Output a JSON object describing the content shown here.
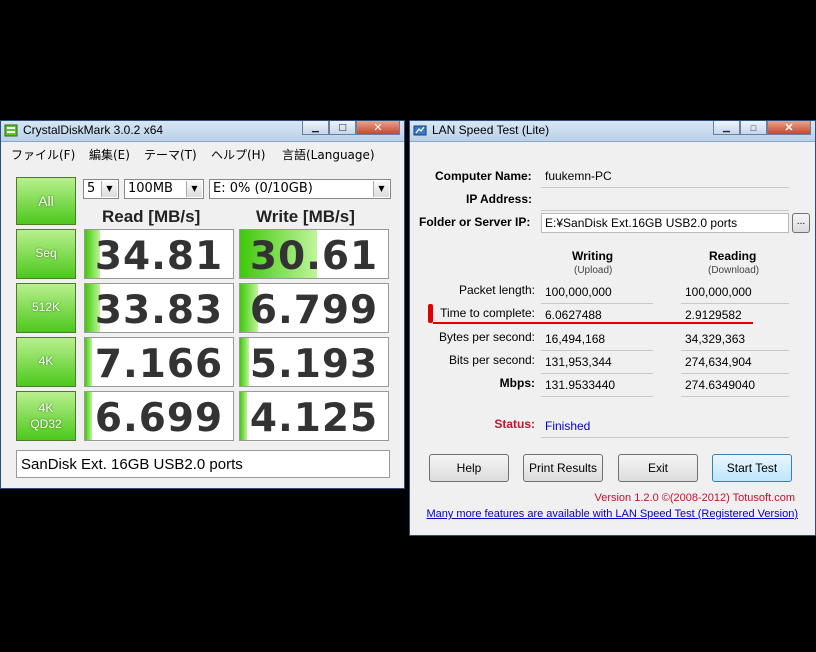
{
  "cdm": {
    "title": "CrystalDiskMark 3.0.2 x64",
    "menu": [
      "ファイル(F)",
      "編集(E)",
      "テーマ(T)",
      "ヘルプ(H)",
      "言語(Language)"
    ],
    "runs": "5",
    "size": "100MB",
    "drive": "E: 0% (0/10GB)",
    "all_label": "All",
    "read_header": "Read [MB/s]",
    "write_header": "Write [MB/s]",
    "tests": [
      {
        "label": "Seq",
        "label2": "",
        "read": "34.81",
        "write": "30.61",
        "read_fill": 0.1,
        "write_fill": 0.52
      },
      {
        "label": "512K",
        "label2": "",
        "read": "33.83",
        "write": "6.799",
        "read_fill": 0.1,
        "write_fill": 0.12
      },
      {
        "label": "4K",
        "label2": "",
        "read": "7.166",
        "write": "5.193",
        "read_fill": 0.05,
        "write_fill": 0.06
      },
      {
        "label": "4K",
        "label2": "QD32",
        "read": "6.699",
        "write": "4.125",
        "read_fill": 0.05,
        "write_fill": 0.05
      }
    ],
    "comment": "SanDisk Ext. 16GB USB2.0 ports",
    "accent": "#4cc81c"
  },
  "lst": {
    "title": "LAN Speed Test (Lite)",
    "computer_name_label": "Computer Name:",
    "computer_name": "fuukemn-PC",
    "ip_label": "IP Address:",
    "ip": "",
    "folder_label": "Folder or Server IP:",
    "folder": "E:¥SanDisk Ext.16GB USB2.0 ports",
    "browse": "...",
    "writing": "Writing",
    "upload": "(Upload)",
    "reading": "Reading",
    "download": "(Download)",
    "rows": [
      {
        "label": "Packet length:",
        "write": "100,000,000",
        "read": "100,000,000"
      },
      {
        "label": "Time to complete:",
        "write": "6.0627488",
        "read": "2.9129582"
      },
      {
        "label": "Bytes per second:",
        "write": "16,494,168",
        "read": "34,329,363"
      },
      {
        "label": "Bits per second:",
        "write": "131,953,344",
        "read": "274,634,904"
      },
      {
        "label": "Mbps:",
        "write": "131.9533440",
        "read": "274.6349040"
      }
    ],
    "status_label": "Status:",
    "status": "Finished",
    "buttons": {
      "help": "Help",
      "print": "Print Results",
      "exit": "Exit",
      "start": "Start Test"
    },
    "version": "Version 1.2.0 ©(2008-2012) Totusoft.com",
    "promo": "Many more features are available with LAN Speed Test (Registered Version)",
    "colors": {
      "status_label": "#c8102e",
      "status_value": "#0000cc",
      "version": "#c8102e",
      "link": "#0000cc",
      "highlight": "#e00000"
    }
  }
}
